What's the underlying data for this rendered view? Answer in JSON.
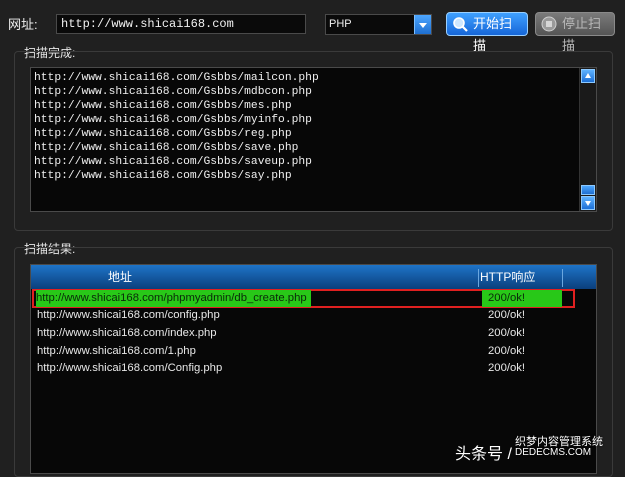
{
  "toolbar": {
    "url_label": "网址:",
    "url_value": "http://www.shicai168.com",
    "script_type": "PHP",
    "start_label": "开始扫描",
    "stop_label": "停止扫描"
  },
  "progress_group": {
    "title": "扫描完成:",
    "lines": [
      "http://www.shicai168.com/Gsbbs/mailcon.php",
      "http://www.shicai168.com/Gsbbs/mdbcon.php",
      "http://www.shicai168.com/Gsbbs/mes.php",
      "http://www.shicai168.com/Gsbbs/myinfo.php",
      "http://www.shicai168.com/Gsbbs/reg.php",
      "http://www.shicai168.com/Gsbbs/save.php",
      "http://www.shicai168.com/Gsbbs/saveup.php",
      "http://www.shicai168.com/Gsbbs/say.php"
    ]
  },
  "results_group": {
    "title": "扫描结果:",
    "columns": [
      "地址",
      "HTTP响应"
    ],
    "rows": [
      {
        "url": "http://www.shicai168.com/phpmyadmin/db_create.php",
        "status": "200/ok!"
      },
      {
        "url": "http://www.shicai168.com/config.php",
        "status": "200/ok!"
      },
      {
        "url": "http://www.shicai168.com/index.php",
        "status": "200/ok!"
      },
      {
        "url": "http://www.shicai168.com/1.php",
        "status": "200/ok!"
      },
      {
        "url": "http://www.shicai168.com/Config.php",
        "status": "200/ok!"
      }
    ]
  },
  "watermark": {
    "author": "头条号 /",
    "site_name": "织梦内容管理系统",
    "site_domain": "DEDECMS.COM"
  },
  "colors": {
    "accent": "#1e6fd1",
    "highlight_row": "#28c818",
    "highlight_border": "#e02020"
  }
}
